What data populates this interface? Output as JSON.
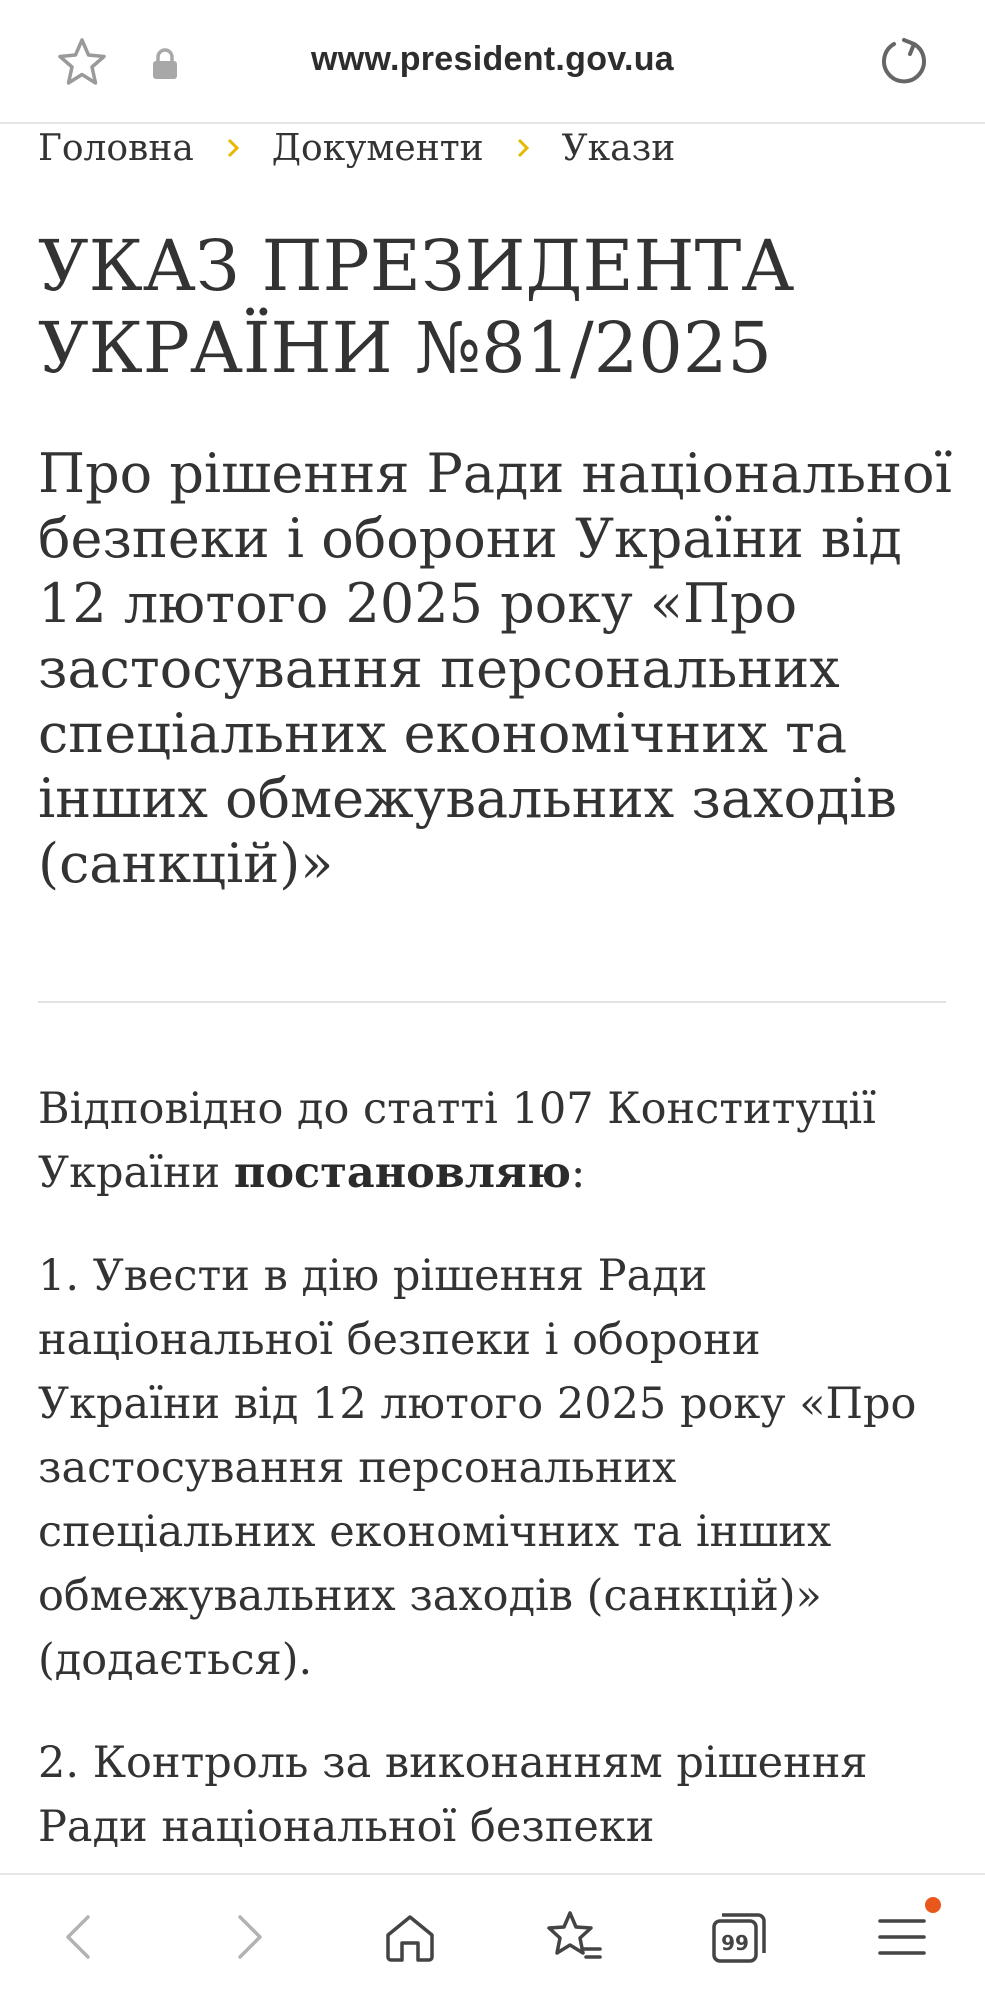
{
  "browser": {
    "url": "www.president.gov.ua",
    "tabs_count": "99",
    "notification_color": "#e8581c"
  },
  "breadcrumb": {
    "items": [
      "Головна",
      "Документи",
      "Укази"
    ],
    "separator_color": "#e6b800"
  },
  "document": {
    "title_line1": "УКАЗ ПРЕЗИДЕНТА",
    "title_line2": "УКРАЇНИ №81/2025",
    "subtitle": "Про рішення Ради національної безпеки і оборони України від 12 лютого 2025 року «Про застосування персональних спеціальних економічних та інших обмежувальних заходів (санкцій)»",
    "p1_text": "Відповідно до статті 107 Конституції України ",
    "p1_bold": "постановляю",
    "p1_end": ":",
    "p2": "1. Увести в дію рішення Ради національної безпеки і оборони України від 12 лютого 2025 року «Про застосування персональних спеціальних економічних та інших обмежувальних заходів (санкцій)» (додається).",
    "p3": "2. Контроль за виконанням рішення Ради національної безпеки"
  },
  "icons": {
    "bookmark": "star-outline-icon",
    "secure": "lock-icon",
    "reload": "reload-icon",
    "back": "chevron-left-icon",
    "forward": "chevron-right-icon",
    "home": "home-icon",
    "bookmarks": "star-list-icon",
    "tabs": "tabs-icon",
    "menu": "menu-icon"
  }
}
